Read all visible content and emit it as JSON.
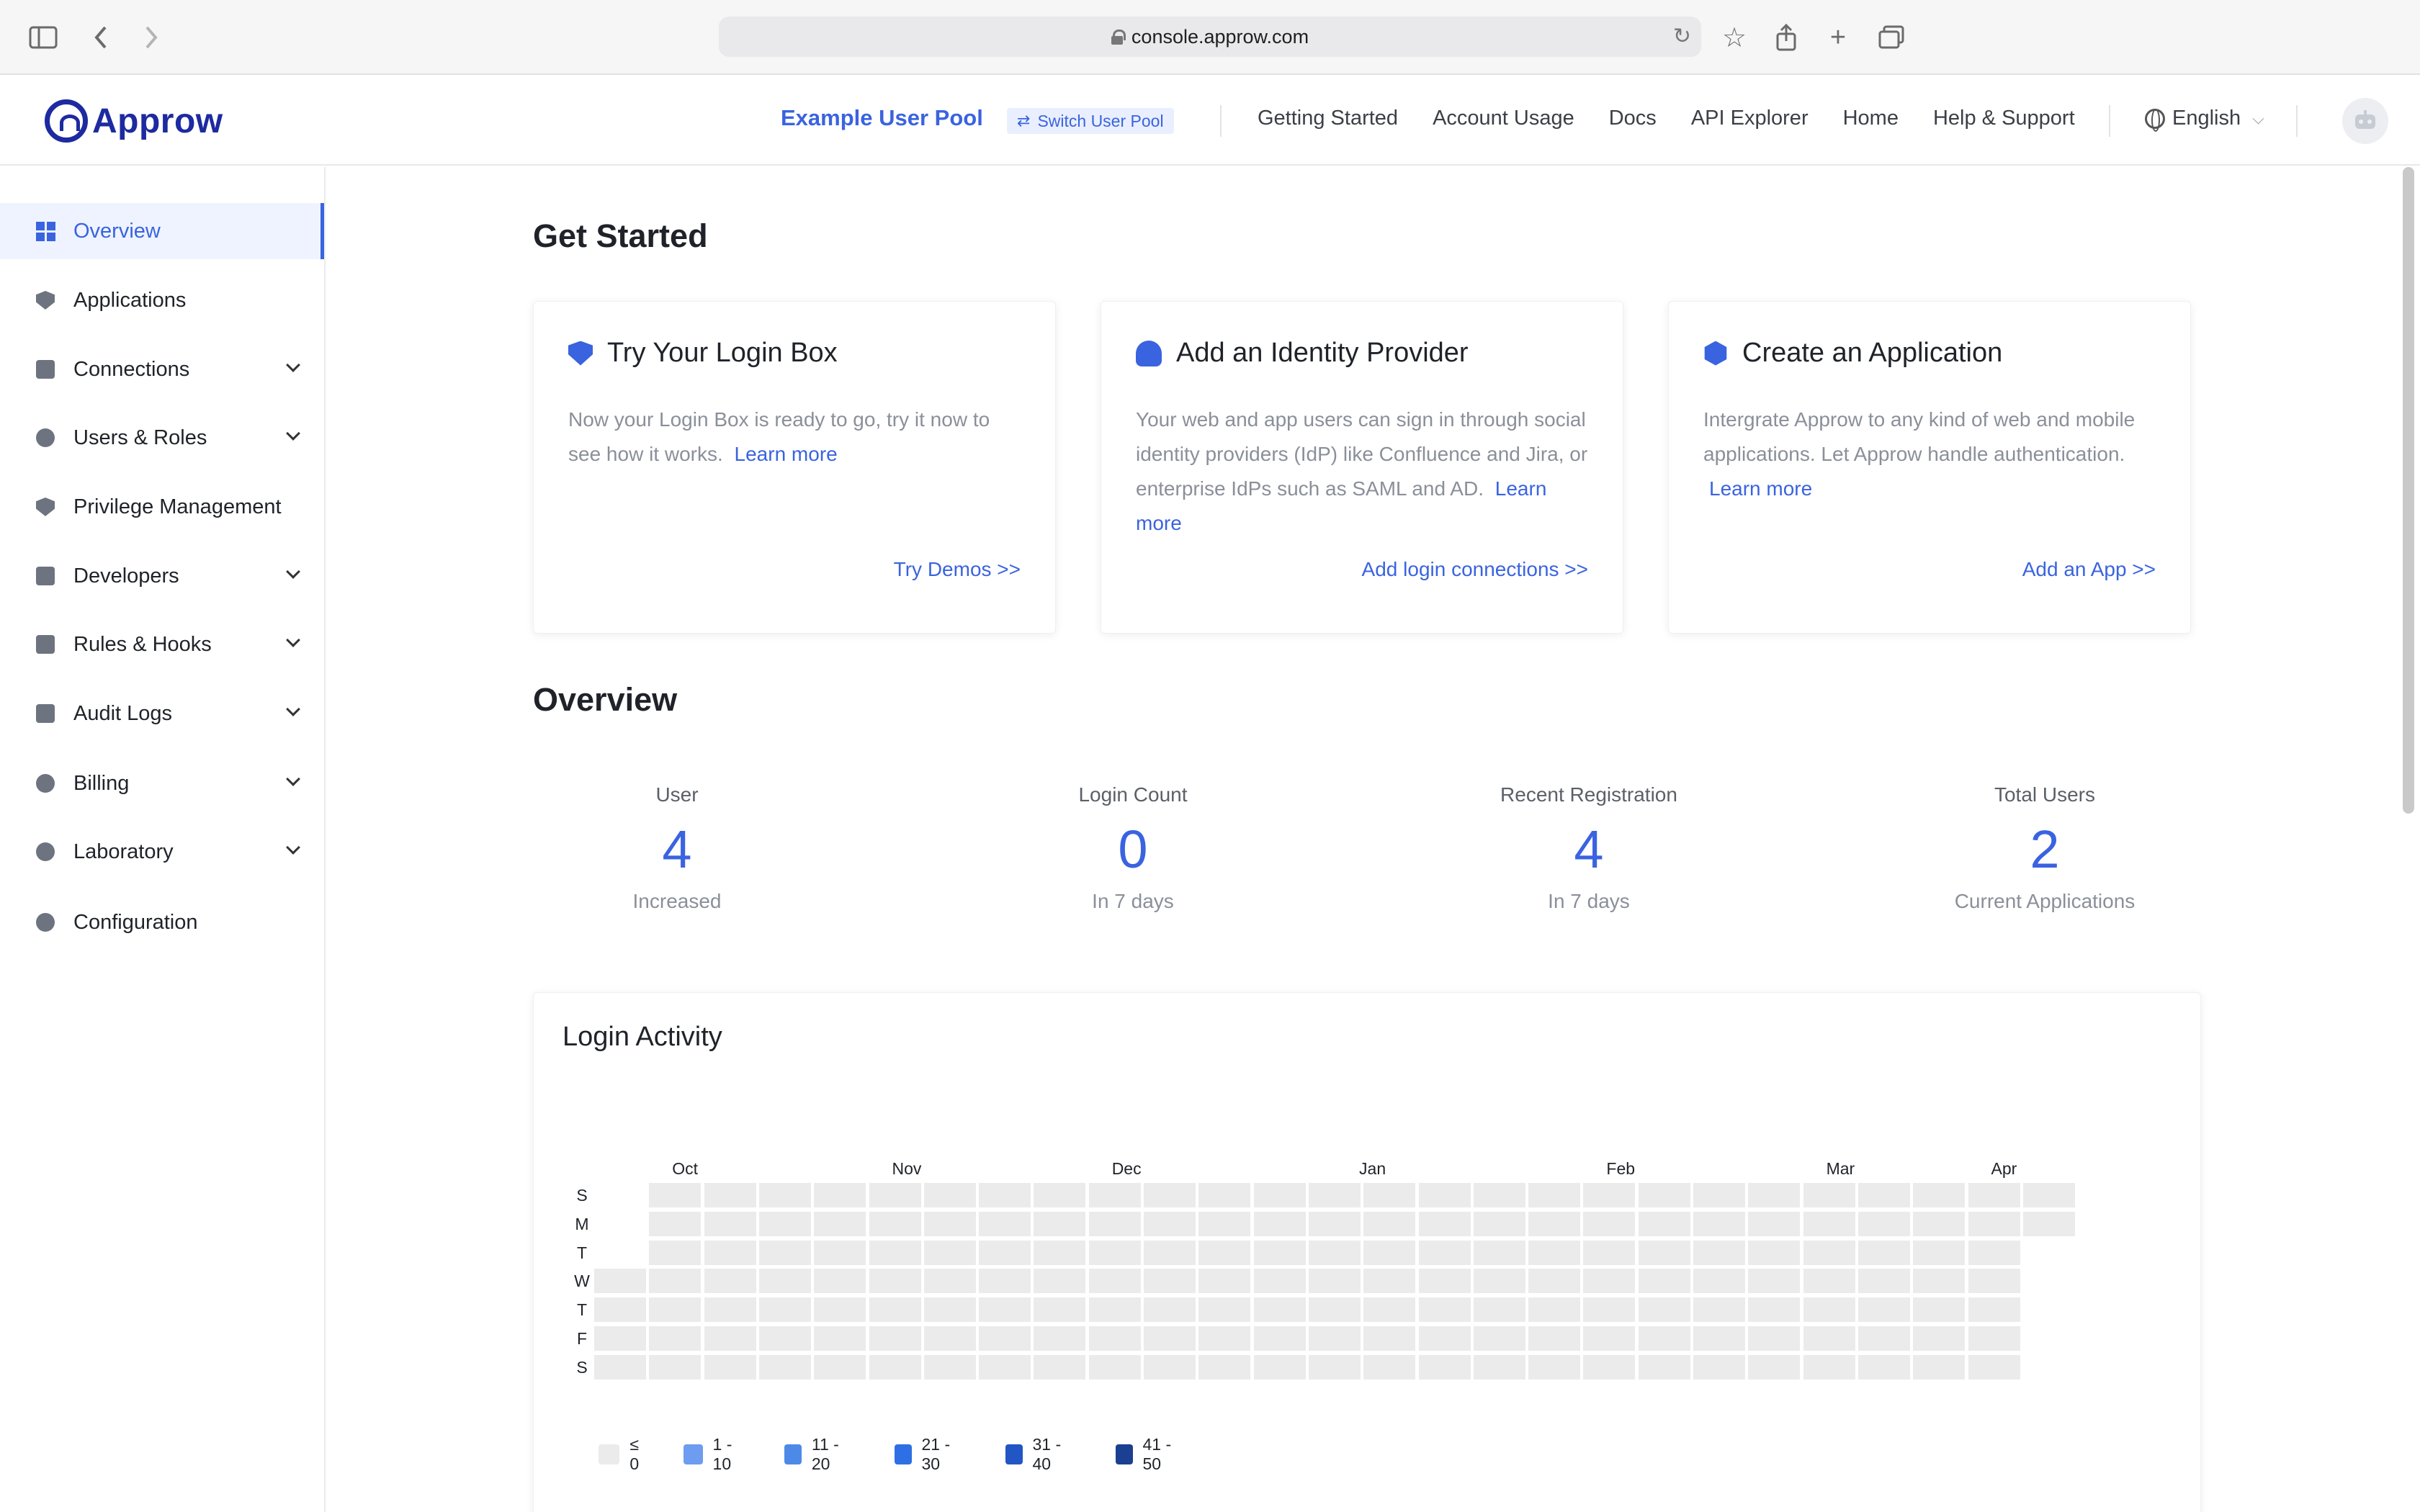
{
  "browser": {
    "url": "console.approw.com"
  },
  "header": {
    "logo_text": "Approw",
    "pool_name": "Example User Pool",
    "switch_label": "Switch User Pool",
    "nav": [
      "Getting Started",
      "Account Usage",
      "Docs",
      "API Explorer",
      "Home",
      "Help & Support"
    ],
    "language": "English"
  },
  "sidebar": {
    "items": [
      {
        "label": "Overview",
        "icon": "dashboard-icon",
        "active": true,
        "expandable": false
      },
      {
        "label": "Applications",
        "icon": "cube-icon",
        "expandable": false
      },
      {
        "label": "Connections",
        "icon": "id-card-icon",
        "expandable": true
      },
      {
        "label": "Users & Roles",
        "icon": "user-icon",
        "expandable": true
      },
      {
        "label": "Privilege Management",
        "icon": "shield-icon",
        "expandable": false
      },
      {
        "label": "Developers",
        "icon": "code-icon",
        "expandable": true
      },
      {
        "label": "Rules & Hooks",
        "icon": "share-icon",
        "expandable": true
      },
      {
        "label": "Audit Logs",
        "icon": "document-icon",
        "expandable": true
      },
      {
        "label": "Billing",
        "icon": "yen-icon",
        "expandable": true
      },
      {
        "label": "Laboratory",
        "icon": "bulb-icon",
        "expandable": true
      },
      {
        "label": "Configuration",
        "icon": "gear-icon",
        "expandable": false
      }
    ]
  },
  "get_started": {
    "title": "Get Started",
    "cards": [
      {
        "title": "Try Your Login Box",
        "body": "Now your Login Box is ready to go, try it now to see how it works.",
        "learn_more": "Learn more",
        "action": "Try Demos >>",
        "icon": "shield-check-icon"
      },
      {
        "title": "Add an Identity Provider",
        "body": "Your web and app users can sign in through social identity providers (IdP) like Confluence and Jira, or enterprise IdPs such as SAML and AD.",
        "learn_more": "Learn more",
        "action": "Add login connections >>",
        "icon": "user-add-icon"
      },
      {
        "title": "Create an Application",
        "body": "Intergrate Approw to any kind of web and mobile applications. Let Approw handle authentication.",
        "learn_more": "Learn more",
        "action": "Add an App >>",
        "icon": "cube-icon"
      }
    ]
  },
  "overview": {
    "title": "Overview",
    "stats": [
      {
        "label": "User",
        "value": "4",
        "sub": "Increased"
      },
      {
        "label": "Login Count",
        "value": "0",
        "sub": "In 7 days"
      },
      {
        "label": "Recent Registration",
        "value": "4",
        "sub": "In 7 days"
      },
      {
        "label": "Total Users",
        "value": "2",
        "sub": "Current Applications"
      }
    ]
  },
  "login_activity": {
    "title": "Login Activity",
    "months": [
      "Oct",
      "Nov",
      "Dec",
      "Jan",
      "Feb",
      "Mar",
      "Apr"
    ],
    "days": [
      "S",
      "M",
      "T",
      "W",
      "T",
      "F",
      "S"
    ],
    "weeks": 27,
    "all_zero": true,
    "legend": [
      {
        "label": "≤ 0",
        "color": "#ebebeb"
      },
      {
        "label": "1 - 10",
        "color": "#6d9cf0"
      },
      {
        "label": "11 - 20",
        "color": "#4d8ae8"
      },
      {
        "label": "21 - 30",
        "color": "#2f6fe6"
      },
      {
        "label": "31 - 40",
        "color": "#2256c4"
      },
      {
        "label": "41 - 50",
        "color": "#1b3f91"
      }
    ]
  },
  "colors": {
    "accent": "#3a63e0",
    "brand": "#1d2aa0"
  }
}
